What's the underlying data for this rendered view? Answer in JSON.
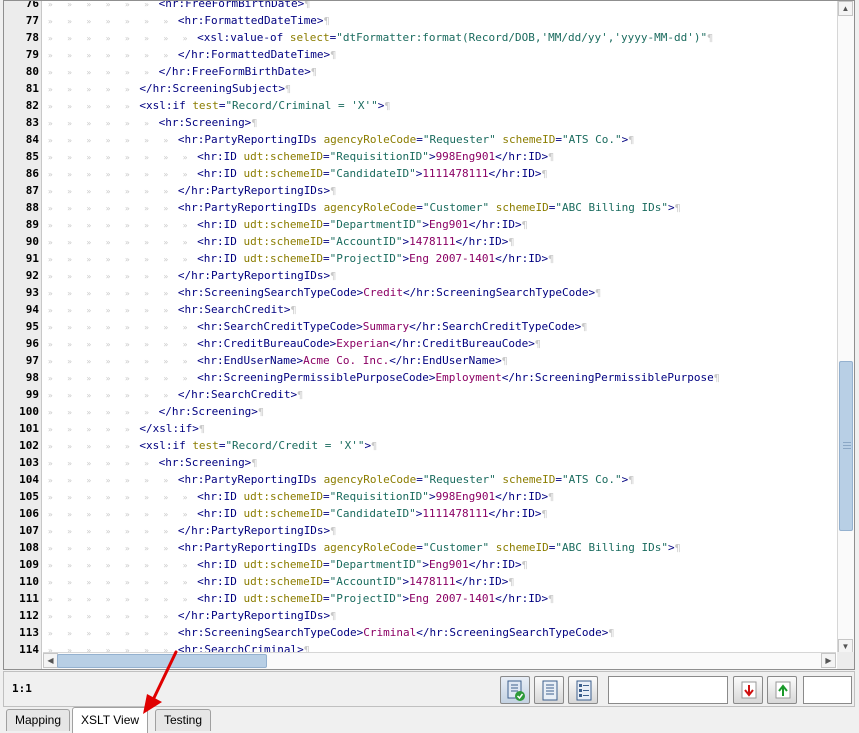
{
  "editor": {
    "lines": [
      {
        "n": "76",
        "indent": 6,
        "toks": [
          [
            "tag",
            "<hr:FreeFormBirthDate>"
          ]
        ]
      },
      {
        "n": "77",
        "indent": 7,
        "toks": [
          [
            "tag",
            "<hr:FormattedDateTime>"
          ]
        ]
      },
      {
        "n": "78",
        "indent": 8,
        "toks": [
          [
            "tag",
            "<xsl:value-of "
          ],
          [
            "att",
            "select"
          ],
          [
            "tag",
            "="
          ],
          [
            "val",
            "\"dtFormatter:format(Record/DOB,'MM/dd/yy','yyyy-MM-dd')\""
          ]
        ]
      },
      {
        "n": "79",
        "indent": 7,
        "toks": [
          [
            "tag",
            "</hr:FormattedDateTime>"
          ]
        ]
      },
      {
        "n": "80",
        "indent": 6,
        "toks": [
          [
            "tag",
            "</hr:FreeFormBirthDate>"
          ]
        ]
      },
      {
        "n": "81",
        "indent": 5,
        "toks": [
          [
            "tag",
            "</hr:ScreeningSubject>"
          ]
        ]
      },
      {
        "n": "82",
        "indent": 5,
        "toks": [
          [
            "tag",
            "<xsl:if "
          ],
          [
            "att",
            "test"
          ],
          [
            "tag",
            "="
          ],
          [
            "val",
            "\"Record/Criminal = 'X'\""
          ],
          [
            "tag",
            ">"
          ]
        ]
      },
      {
        "n": "83",
        "indent": 6,
        "toks": [
          [
            "tag",
            "<hr:Screening>"
          ]
        ]
      },
      {
        "n": "84",
        "indent": 7,
        "toks": [
          [
            "tag",
            "<hr:PartyReportingIDs "
          ],
          [
            "att",
            "agencyRoleCode"
          ],
          [
            "tag",
            "="
          ],
          [
            "val",
            "\"Requester\""
          ],
          [
            "tag",
            " "
          ],
          [
            "att",
            "schemeID"
          ],
          [
            "tag",
            "="
          ],
          [
            "val",
            "\"ATS Co.\""
          ],
          [
            "tag",
            ">"
          ]
        ]
      },
      {
        "n": "85",
        "indent": 8,
        "toks": [
          [
            "tag",
            "<hr:ID "
          ],
          [
            "att",
            "udt:schemeID"
          ],
          [
            "tag",
            "="
          ],
          [
            "val",
            "\"RequisitionID\""
          ],
          [
            "tag",
            ">"
          ],
          [
            "txt",
            "998Eng901"
          ],
          [
            "tag",
            "</hr:ID>"
          ]
        ]
      },
      {
        "n": "86",
        "indent": 8,
        "toks": [
          [
            "tag",
            "<hr:ID "
          ],
          [
            "att",
            "udt:schemeID"
          ],
          [
            "tag",
            "="
          ],
          [
            "val",
            "\"CandidateID\""
          ],
          [
            "tag",
            ">"
          ],
          [
            "txt",
            "1111478111"
          ],
          [
            "tag",
            "</hr:ID>"
          ]
        ]
      },
      {
        "n": "87",
        "indent": 7,
        "toks": [
          [
            "tag",
            "</hr:PartyReportingIDs>"
          ]
        ]
      },
      {
        "n": "88",
        "indent": 7,
        "toks": [
          [
            "tag",
            "<hr:PartyReportingIDs "
          ],
          [
            "att",
            "agencyRoleCode"
          ],
          [
            "tag",
            "="
          ],
          [
            "val",
            "\"Customer\""
          ],
          [
            "tag",
            " "
          ],
          [
            "att",
            "schemeID"
          ],
          [
            "tag",
            "="
          ],
          [
            "val",
            "\"ABC Billing IDs\""
          ],
          [
            "tag",
            ">"
          ]
        ]
      },
      {
        "n": "89",
        "indent": 8,
        "toks": [
          [
            "tag",
            "<hr:ID "
          ],
          [
            "att",
            "udt:schemeID"
          ],
          [
            "tag",
            "="
          ],
          [
            "val",
            "\"DepartmentID\""
          ],
          [
            "tag",
            ">"
          ],
          [
            "txt",
            "Eng901"
          ],
          [
            "tag",
            "</hr:ID>"
          ]
        ]
      },
      {
        "n": "90",
        "indent": 8,
        "toks": [
          [
            "tag",
            "<hr:ID "
          ],
          [
            "att",
            "udt:schemeID"
          ],
          [
            "tag",
            "="
          ],
          [
            "val",
            "\"AccountID\""
          ],
          [
            "tag",
            ">"
          ],
          [
            "txt",
            "1478111"
          ],
          [
            "tag",
            "</hr:ID>"
          ]
        ]
      },
      {
        "n": "91",
        "indent": 8,
        "toks": [
          [
            "tag",
            "<hr:ID "
          ],
          [
            "att",
            "udt:schemeID"
          ],
          [
            "tag",
            "="
          ],
          [
            "val",
            "\"ProjectID\""
          ],
          [
            "tag",
            ">"
          ],
          [
            "txt",
            "Eng 2007-1401"
          ],
          [
            "tag",
            "</hr:ID>"
          ]
        ]
      },
      {
        "n": "92",
        "indent": 7,
        "toks": [
          [
            "tag",
            "</hr:PartyReportingIDs>"
          ]
        ]
      },
      {
        "n": "93",
        "indent": 7,
        "toks": [
          [
            "tag",
            "<hr:ScreeningSearchTypeCode>"
          ],
          [
            "txt",
            "Credit"
          ],
          [
            "tag",
            "</hr:ScreeningSearchTypeCode>"
          ]
        ]
      },
      {
        "n": "94",
        "indent": 7,
        "toks": [
          [
            "tag",
            "<hr:SearchCredit>"
          ]
        ]
      },
      {
        "n": "95",
        "indent": 8,
        "toks": [
          [
            "tag",
            "<hr:SearchCreditTypeCode>"
          ],
          [
            "txt",
            "Summary"
          ],
          [
            "tag",
            "</hr:SearchCreditTypeCode>"
          ]
        ]
      },
      {
        "n": "96",
        "indent": 8,
        "toks": [
          [
            "tag",
            "<hr:CreditBureauCode>"
          ],
          [
            "txt",
            "Experian"
          ],
          [
            "tag",
            "</hr:CreditBureauCode>"
          ]
        ]
      },
      {
        "n": "97",
        "indent": 8,
        "toks": [
          [
            "tag",
            "<hr:EndUserName>"
          ],
          [
            "txt",
            "Acme Co. Inc."
          ],
          [
            "tag",
            "</hr:EndUserName>"
          ]
        ]
      },
      {
        "n": "98",
        "indent": 8,
        "toks": [
          [
            "tag",
            "<hr:ScreeningPermissiblePurposeCode>"
          ],
          [
            "txt",
            "Employment"
          ],
          [
            "tag",
            "</hr:ScreeningPermissiblePurpose"
          ]
        ]
      },
      {
        "n": "99",
        "indent": 7,
        "toks": [
          [
            "tag",
            "</hr:SearchCredit>"
          ]
        ]
      },
      {
        "n": "100",
        "indent": 6,
        "toks": [
          [
            "tag",
            "</hr:Screening>"
          ]
        ]
      },
      {
        "n": "101",
        "indent": 5,
        "toks": [
          [
            "tag",
            "</xsl:if>"
          ]
        ]
      },
      {
        "n": "102",
        "indent": 5,
        "toks": [
          [
            "tag",
            "<xsl:if "
          ],
          [
            "att",
            "test"
          ],
          [
            "tag",
            "="
          ],
          [
            "val",
            "\"Record/Credit = 'X'\""
          ],
          [
            "tag",
            ">"
          ]
        ]
      },
      {
        "n": "103",
        "indent": 6,
        "toks": [
          [
            "tag",
            "<hr:Screening>"
          ]
        ]
      },
      {
        "n": "104",
        "indent": 7,
        "toks": [
          [
            "tag",
            "<hr:PartyReportingIDs "
          ],
          [
            "att",
            "agencyRoleCode"
          ],
          [
            "tag",
            "="
          ],
          [
            "val",
            "\"Requester\""
          ],
          [
            "tag",
            " "
          ],
          [
            "att",
            "schemeID"
          ],
          [
            "tag",
            "="
          ],
          [
            "val",
            "\"ATS Co.\""
          ],
          [
            "tag",
            ">"
          ]
        ]
      },
      {
        "n": "105",
        "indent": 8,
        "toks": [
          [
            "tag",
            "<hr:ID "
          ],
          [
            "att",
            "udt:schemeID"
          ],
          [
            "tag",
            "="
          ],
          [
            "val",
            "\"RequisitionID\""
          ],
          [
            "tag",
            ">"
          ],
          [
            "txt",
            "998Eng901"
          ],
          [
            "tag",
            "</hr:ID>"
          ]
        ]
      },
      {
        "n": "106",
        "indent": 8,
        "toks": [
          [
            "tag",
            "<hr:ID "
          ],
          [
            "att",
            "udt:schemeID"
          ],
          [
            "tag",
            "="
          ],
          [
            "val",
            "\"CandidateID\""
          ],
          [
            "tag",
            ">"
          ],
          [
            "txt",
            "1111478111"
          ],
          [
            "tag",
            "</hr:ID>"
          ]
        ]
      },
      {
        "n": "107",
        "indent": 7,
        "toks": [
          [
            "tag",
            "</hr:PartyReportingIDs>"
          ]
        ]
      },
      {
        "n": "108",
        "indent": 7,
        "toks": [
          [
            "tag",
            "<hr:PartyReportingIDs "
          ],
          [
            "att",
            "agencyRoleCode"
          ],
          [
            "tag",
            "="
          ],
          [
            "val",
            "\"Customer\""
          ],
          [
            "tag",
            " "
          ],
          [
            "att",
            "schemeID"
          ],
          [
            "tag",
            "="
          ],
          [
            "val",
            "\"ABC Billing IDs\""
          ],
          [
            "tag",
            ">"
          ]
        ]
      },
      {
        "n": "109",
        "indent": 8,
        "toks": [
          [
            "tag",
            "<hr:ID "
          ],
          [
            "att",
            "udt:schemeID"
          ],
          [
            "tag",
            "="
          ],
          [
            "val",
            "\"DepartmentID\""
          ],
          [
            "tag",
            ">"
          ],
          [
            "txt",
            "Eng901"
          ],
          [
            "tag",
            "</hr:ID>"
          ]
        ]
      },
      {
        "n": "110",
        "indent": 8,
        "toks": [
          [
            "tag",
            "<hr:ID "
          ],
          [
            "att",
            "udt:schemeID"
          ],
          [
            "tag",
            "="
          ],
          [
            "val",
            "\"AccountID\""
          ],
          [
            "tag",
            ">"
          ],
          [
            "txt",
            "1478111"
          ],
          [
            "tag",
            "</hr:ID>"
          ]
        ]
      },
      {
        "n": "111",
        "indent": 8,
        "toks": [
          [
            "tag",
            "<hr:ID "
          ],
          [
            "att",
            "udt:schemeID"
          ],
          [
            "tag",
            "="
          ],
          [
            "val",
            "\"ProjectID\""
          ],
          [
            "tag",
            ">"
          ],
          [
            "txt",
            "Eng 2007-1401"
          ],
          [
            "tag",
            "</hr:ID>"
          ]
        ]
      },
      {
        "n": "112",
        "indent": 7,
        "toks": [
          [
            "tag",
            "</hr:PartyReportingIDs>"
          ]
        ]
      },
      {
        "n": "113",
        "indent": 7,
        "toks": [
          [
            "tag",
            "<hr:ScreeningSearchTypeCode>"
          ],
          [
            "txt",
            "Criminal"
          ],
          [
            "tag",
            "</hr:ScreeningSearchTypeCode>"
          ]
        ]
      },
      {
        "n": "114",
        "indent": 7,
        "toks": [
          [
            "tag",
            "<hr:SearchCriminal>"
          ]
        ]
      }
    ]
  },
  "status": {
    "position": "1:1"
  },
  "toolbar": {
    "icons": [
      "validate-document-icon",
      "document-view-icon",
      "document-outline-icon",
      "find-next-down-icon",
      "find-previous-up-icon"
    ],
    "find_value": "",
    "extra_value": ""
  },
  "tabs": [
    {
      "label": "Mapping",
      "active": false
    },
    {
      "label": "XSLT View",
      "active": true
    },
    {
      "label": "Testing",
      "active": false
    }
  ],
  "colors": {
    "tag": "#000080",
    "attribute": "#8b7d00",
    "value": "#1a6b5e",
    "text": "#8b0064",
    "annotation_arrow": "#e00000"
  }
}
